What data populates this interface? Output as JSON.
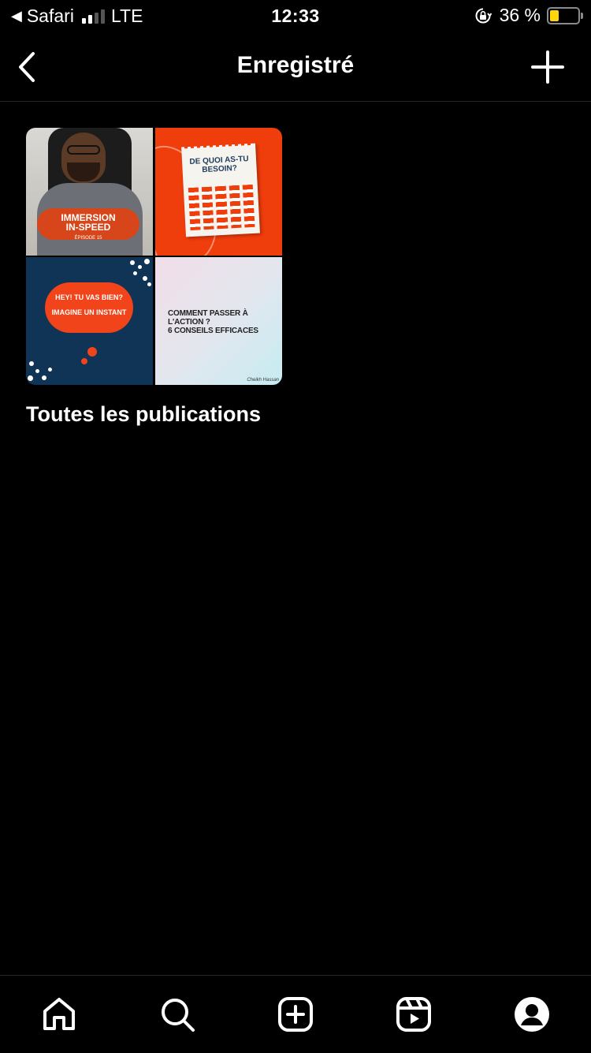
{
  "status_bar": {
    "back_app": "Safari",
    "network": "LTE",
    "time": "12:33",
    "battery_text": "36 %",
    "battery_level": 0.36,
    "battery_color": "#ffd60a"
  },
  "header": {
    "title": "Enregistré"
  },
  "collection": {
    "name": "Toutes les publications",
    "thumbnails": [
      {
        "line1": "IMMERSION",
        "line2": "IN-SPEED",
        "sub": "ÉPISODE 15"
      },
      {
        "title": "DE QUOI AS-TU BESOIN?"
      },
      {
        "line1": "HEY! TU VAS BIEN?",
        "line2": "IMAGINE UN INSTANT"
      },
      {
        "line1": "COMMENT PASSER À L'ACTION ?",
        "line2": "6 CONSEILS EFFICACES",
        "signature": "Cheikh Hassan"
      }
    ]
  },
  "tabbar": {
    "items": [
      "home-icon",
      "search-icon",
      "new-post-icon",
      "reels-icon",
      "profile-icon"
    ]
  },
  "colors": {
    "background": "#000000",
    "divider": "#262626",
    "text": "#ffffff"
  }
}
